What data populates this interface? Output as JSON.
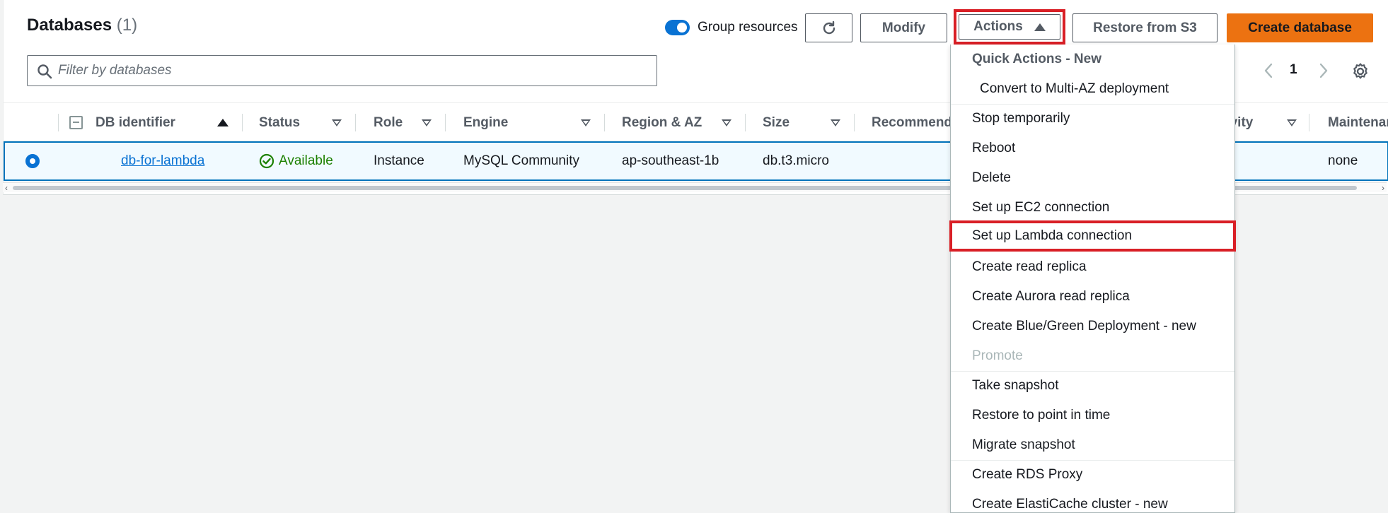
{
  "header": {
    "title": "Databases",
    "count": "(1)",
    "group_resources_label": "Group resources",
    "group_resources_on": true
  },
  "toolbar": {
    "modify_label": "Modify",
    "actions_label": "Actions",
    "restore_label": "Restore from S3",
    "create_label": "Create database"
  },
  "filter": {
    "placeholder": "Filter by databases"
  },
  "pagination": {
    "current_page": "1"
  },
  "table": {
    "columns": [
      "DB identifier",
      "Status",
      "Role",
      "Engine",
      "Region & AZ",
      "Size",
      "Recommend",
      "tivity",
      "Maintenan"
    ],
    "rows": [
      {
        "identifier": "db-for-lambda",
        "status": "Available",
        "role": "Instance",
        "engine": "MySQL Community",
        "region": "ap-southeast-1b",
        "size": "db.t3.micro",
        "maintenance": "none"
      }
    ]
  },
  "actions_menu": {
    "items": [
      {
        "label": "Quick Actions - New",
        "type": "header"
      },
      {
        "label": "Convert to Multi-AZ deployment",
        "type": "sub"
      },
      {
        "label": "Stop temporarily",
        "type": "item"
      },
      {
        "label": "Reboot",
        "type": "item"
      },
      {
        "label": "Delete",
        "type": "item"
      },
      {
        "label": "Set up EC2 connection",
        "type": "item"
      },
      {
        "label": "Set up Lambda connection",
        "type": "highlighted"
      },
      {
        "label": "Create read replica",
        "type": "item"
      },
      {
        "label": "Create Aurora read replica",
        "type": "item"
      },
      {
        "label": "Create Blue/Green Deployment - new",
        "type": "item"
      },
      {
        "label": "Promote",
        "type": "disabled"
      },
      {
        "label": "Take snapshot",
        "type": "item"
      },
      {
        "label": "Restore to point in time",
        "type": "item"
      },
      {
        "label": "Migrate snapshot",
        "type": "item"
      },
      {
        "label": "Create RDS Proxy",
        "type": "item"
      },
      {
        "label": "Create ElastiCache cluster - new",
        "type": "item"
      }
    ]
  },
  "colors": {
    "accent": "#0972d3",
    "primary_button": "#ec7211",
    "highlight_border": "#d91f26",
    "success": "#1d8102"
  },
  "icons": {
    "refresh": "refresh-icon",
    "search": "search-icon",
    "settings": "gear-icon",
    "status": "check-circle-icon"
  }
}
